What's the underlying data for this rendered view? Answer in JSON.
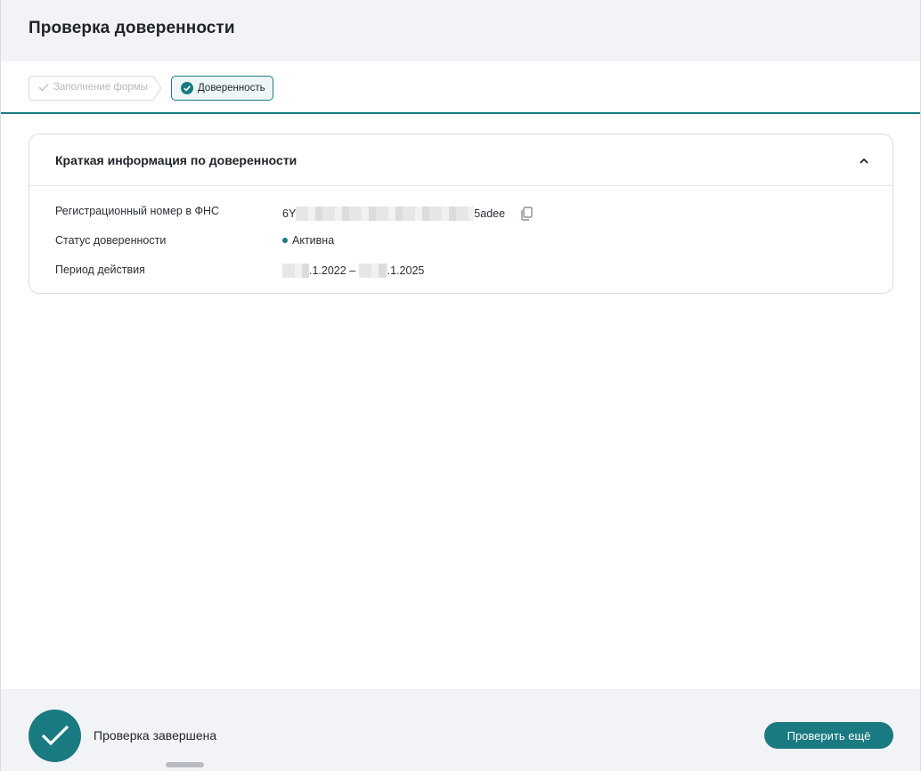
{
  "page": {
    "title": "Проверка доверенности"
  },
  "steps": [
    {
      "label": "Заполнение формы",
      "state": "completed"
    },
    {
      "label": "Доверенность",
      "state": "active"
    }
  ],
  "card": {
    "title": "Краткая информация по доверенности",
    "collapse_icon": "chevron-up-icon",
    "rows": [
      {
        "label": "Регистрационный номер в ФНС",
        "value_prefix": "6Y",
        "value_suffix": "5adee",
        "redacted": true
      },
      {
        "label": "Статус доверенности",
        "value": "Активна"
      },
      {
        "label": "Период действия",
        "date_from_suffix": ".1.2022",
        "date_separator": "–",
        "date_to_suffix": ".1.2025"
      }
    ]
  },
  "footer": {
    "status_text": "Проверка завершена",
    "button_label": "Проверить ещё"
  },
  "colors": {
    "accent": "#1a7a82",
    "header_bg": "#f2f3f6"
  }
}
